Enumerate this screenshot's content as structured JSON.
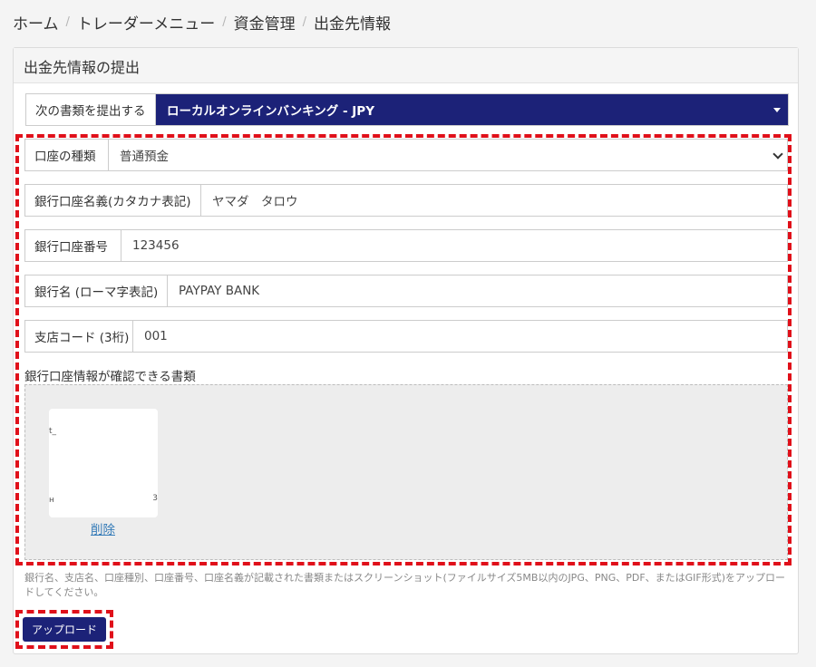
{
  "breadcrumb": [
    "ホーム",
    "トレーダーメニュー",
    "資金管理",
    "出金先情報"
  ],
  "panel": {
    "title": "出金先情報の提出"
  },
  "document_select": {
    "label": "次の書類を提出する",
    "value": "ローカルオンラインバンキング - JPY"
  },
  "fields": {
    "account_type": {
      "label": "口座の種類",
      "value": "普通預金"
    },
    "account_name": {
      "label": "銀行口座名義(カタカナ表記)",
      "value": "ヤマダ　タロウ"
    },
    "account_number": {
      "label": "銀行口座番号",
      "value": "123456"
    },
    "bank_name": {
      "label": "銀行名 (ローマ字表記)",
      "value": "PAYPAY BANK"
    },
    "branch_code": {
      "label": "支店コード (3桁)",
      "value": "001"
    }
  },
  "documents": {
    "title": "銀行口座情報が確認できる書類",
    "delete_label": "削除",
    "thumb_marks": [
      "t_",
      "ʜ",
      "3"
    ]
  },
  "help_text": "銀行名、支店名、口座種別、口座番号、口座名義が記載された書類またはスクリーンショット(ファイルサイズ5MB以内のJPG、PNG、PDF、またはGIF形式)をアップロードしてください。",
  "upload_button": "アップロード",
  "colors": {
    "primary": "#1c2278",
    "highlight": "#e0101a",
    "link": "#337ab7"
  }
}
